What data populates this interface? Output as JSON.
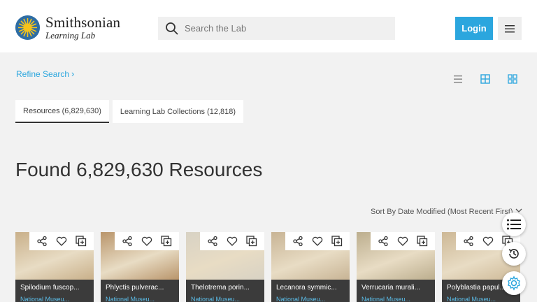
{
  "header": {
    "logo_name": "Smithsonian",
    "logo_sub": "Learning Lab",
    "search_placeholder": "Search the Lab",
    "login_label": "Login"
  },
  "toolbar": {
    "refine_label": "Refine Search"
  },
  "tabs": [
    {
      "label": "Resources (6,829,630)",
      "active": true
    },
    {
      "label": "Learning Lab Collections (12,818)",
      "active": false
    }
  ],
  "results": {
    "heading": "Found 6,829,630 Resources",
    "sort_label": "Sort By Date Modified (Most Recent First)"
  },
  "cards": [
    {
      "title": "Spilodium fuscop...",
      "source": "National Museu...",
      "bg": "#c9b08a"
    },
    {
      "title": "Phlyctis pulverac...",
      "source": "National Museu...",
      "bg": "#b9956b"
    },
    {
      "title": "Thelotrema porin...",
      "source": "National Museu...",
      "bg": "#d8d2c4"
    },
    {
      "title": "Lecanora symmic...",
      "source": "National Museu...",
      "bg": "#c8b495"
    },
    {
      "title": "Verrucaria murali...",
      "source": "National Museu...",
      "bg": "#bcae8e"
    },
    {
      "title": "Polyblastia papul...",
      "source": "National Museu...",
      "bg": "#cdb896"
    }
  ],
  "colors": {
    "accent": "#2ba6de",
    "card_footer": "#3b3b3b"
  }
}
